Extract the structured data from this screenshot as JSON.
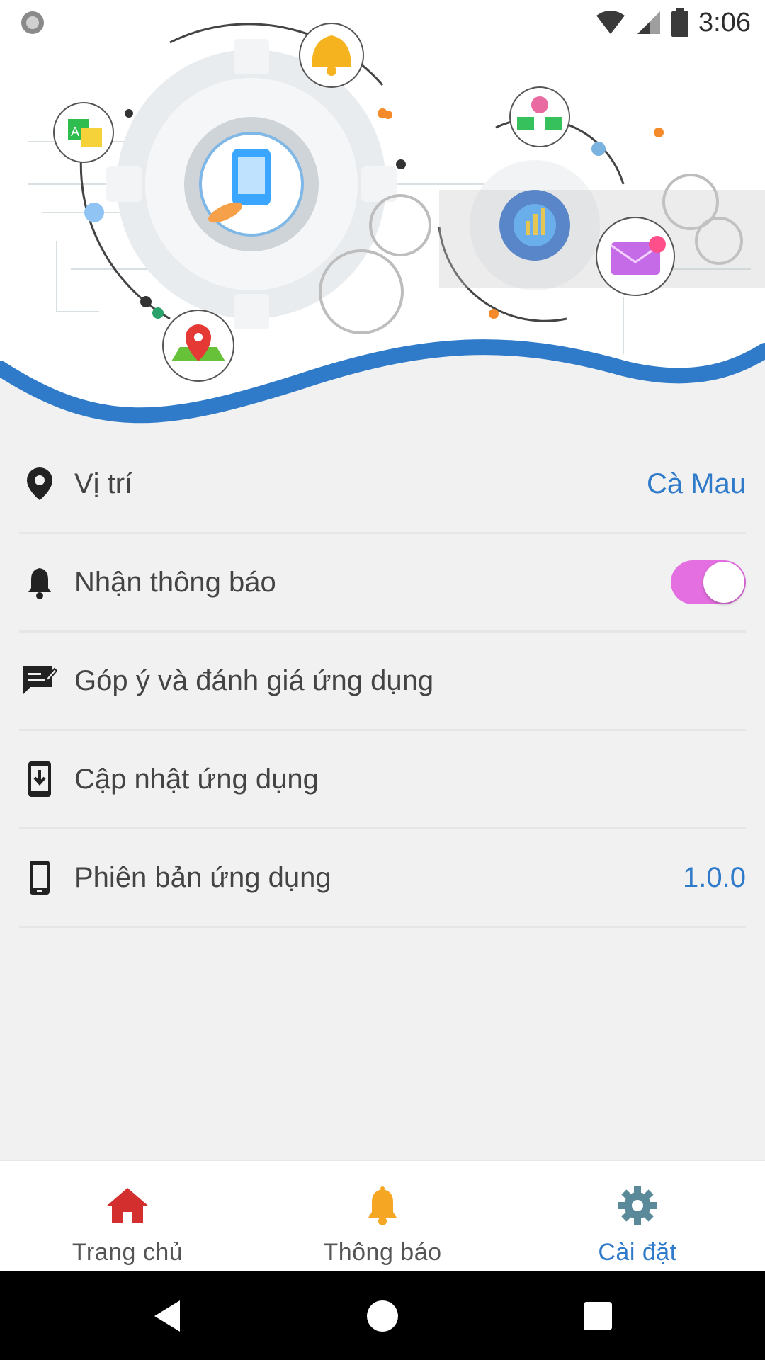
{
  "status_bar": {
    "time": "3:06",
    "icons": [
      "record-icon",
      "wifi-icon",
      "signal-icon",
      "battery-icon"
    ]
  },
  "header": {
    "illustration_icons": [
      "gear-icon",
      "bell-icon",
      "translate-icon",
      "phone-touch-icon",
      "map-pin-icon",
      "version-icon",
      "growth-gear-icon",
      "mail-icon"
    ],
    "wave_color": "#2f7ac9"
  },
  "settings": {
    "location": {
      "label": "Vị trí",
      "value": "Cà Mau",
      "icon": "location-pin-icon"
    },
    "notifications": {
      "label": "Nhận thông báo",
      "enabled": true,
      "icon": "bell-icon"
    },
    "feedback": {
      "label": "Góp ý và đánh giá ứng dụng",
      "icon": "feedback-icon"
    },
    "update": {
      "label": "Cập nhật ứng dụng",
      "icon": "download-icon"
    },
    "version": {
      "label": "Phiên bản ứng dụng",
      "value": "1.0.0",
      "icon": "phone-icon"
    }
  },
  "bottom_nav": {
    "items": [
      {
        "label": "Trang chủ",
        "icon": "home-icon",
        "active": false
      },
      {
        "label": "Thông báo",
        "icon": "bell-icon",
        "active": false
      },
      {
        "label": "Cài đặt",
        "icon": "gear-icon",
        "active": true
      }
    ]
  },
  "colors": {
    "accent": "#2f7ac9",
    "toggle_on": "#e46fe0",
    "home_red": "#d32f2f",
    "bell_orange": "#f5a623",
    "gear_teal": "#5a8a9a"
  }
}
